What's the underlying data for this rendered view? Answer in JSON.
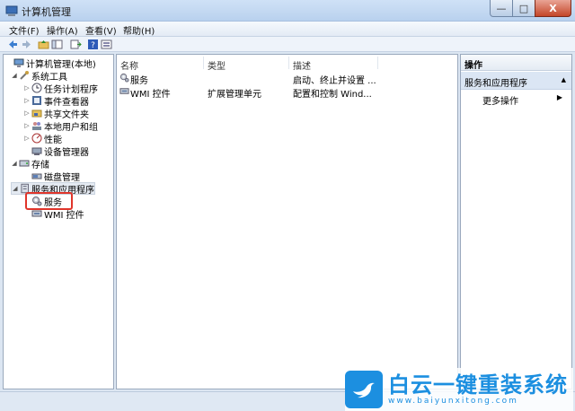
{
  "window": {
    "title": "计算机管理",
    "controls": [
      "—",
      "□",
      "X"
    ]
  },
  "menu": [
    "文件(F)",
    "操作(A)",
    "查看(V)",
    "帮助(H)"
  ],
  "tree": [
    {
      "label": "计算机管理(本地)",
      "icon": "computer-icon"
    },
    {
      "label": "系统工具",
      "icon": "tools-icon"
    },
    {
      "label": "任务计划程序",
      "icon": "clock-icon"
    },
    {
      "label": "事件查看器",
      "icon": "event-viewer-icon"
    },
    {
      "label": "共享文件夹",
      "icon": "shared-folder-icon"
    },
    {
      "label": "本地用户和组",
      "icon": "users-icon"
    },
    {
      "label": "性能",
      "icon": "performance-icon"
    },
    {
      "label": "设备管理器",
      "icon": "device-manager-icon"
    },
    {
      "label": "存储",
      "icon": "storage-icon"
    },
    {
      "label": "磁盘管理",
      "icon": "disk-icon"
    },
    {
      "label": "服务和应用程序",
      "icon": "services-apps-icon"
    },
    {
      "label": "服务",
      "icon": "services-icon"
    },
    {
      "label": "WMI 控件",
      "icon": "wmi-icon"
    }
  ],
  "list": {
    "columns": [
      "名称",
      "类型",
      "描述"
    ],
    "rows": [
      {
        "name": "服务",
        "type": "",
        "desc": "启动、终止并设置 ..."
      },
      {
        "name": "WMI 控件",
        "type": "扩展管理单元",
        "desc": "配置和控制 Wind..."
      }
    ]
  },
  "actions": {
    "title": "操作",
    "group": "服务和应用程序",
    "more": "更多操作"
  },
  "watermark": {
    "text": "白云一键重装系统",
    "url": "www.baiyunxitong.com"
  },
  "colors": {
    "highlight_box": "#e0352b",
    "brand_blue": "#1c8fe0"
  }
}
